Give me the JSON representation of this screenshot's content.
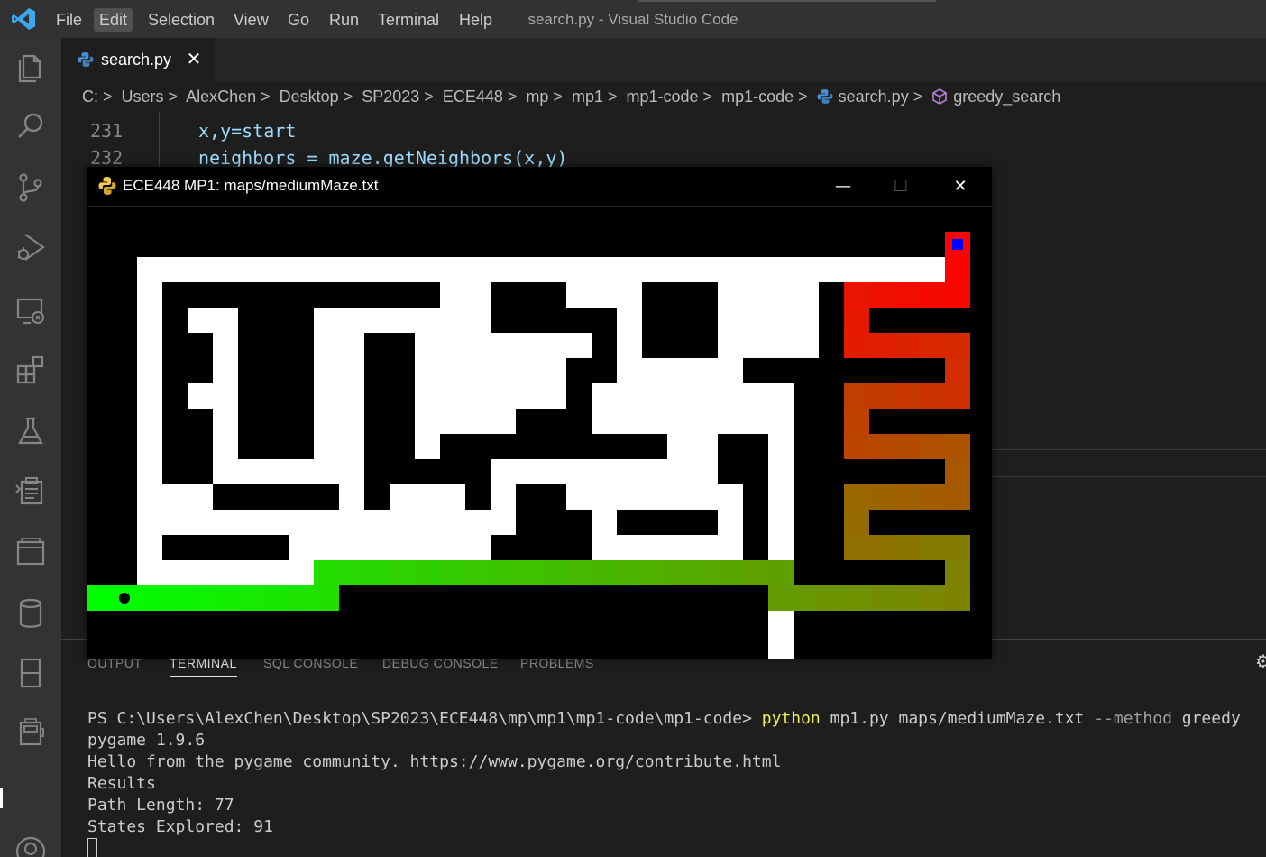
{
  "menubar": {
    "items": [
      "File",
      "Edit",
      "Selection",
      "View",
      "Go",
      "Run",
      "Terminal",
      "Help"
    ],
    "active": "Edit"
  },
  "window_title": "search.py - Visual Studio Code",
  "activity_bar": {
    "icons": [
      "explorer-icon",
      "search-icon",
      "source-control-icon",
      "run-debug-icon",
      "remote-explorer-icon",
      "extensions-icon",
      "testing-icon",
      "clipboard-icon",
      "window-icon",
      "database-icon",
      "notebook-icon",
      "panel-icon",
      "account-icon"
    ]
  },
  "tab": {
    "label": "search.py",
    "close": "✕"
  },
  "breadcrumb": {
    "items": [
      "C:",
      "Users",
      "AlexChen",
      "Desktop",
      "SP2023",
      "ECE448",
      "mp",
      "mp1",
      "mp1-code",
      "mp1-code",
      "search.py",
      "greedy_search"
    ],
    "separator": ">"
  },
  "editor": {
    "lines": [
      {
        "num": "231",
        "code": "x,y=start"
      },
      {
        "num": "232",
        "code": "neighbors = maze.getNeighbors(x,y)"
      }
    ]
  },
  "pygame_window": {
    "title": "ECE448 MP1: maps/mediumMaze.txt",
    "minimize": "—",
    "close": "✕"
  },
  "maze": {
    "wall_color": "#ffffff",
    "floor_color": "#000000",
    "start_color": "#0000ff",
    "path_start_color": "#ff0000",
    "path_end_color": "#00ff00",
    "goal_dot_color": "#000000"
  },
  "panel": {
    "tabs": [
      "OUTPUT",
      "TERMINAL",
      "SQL CONSOLE",
      "DEBUG CONSOLE",
      "PROBLEMS"
    ],
    "active_tab": "TERMINAL"
  },
  "terminal": {
    "prompt": "PS C:\\Users\\AlexChen\\Desktop\\SP2023\\ECE448\\mp\\mp1\\mp1-code\\mp1-code> ",
    "command": "python",
    "args_1": " mp1.py maps/mediumMaze.txt ",
    "flag": "--method",
    "args_2": " greedy",
    "output": [
      "pygame 1.9.6",
      "Hello from the pygame community. https://www.pygame.org/contribute.html",
      "Results",
      "Path Length: 77",
      "States Explored: 91"
    ]
  }
}
